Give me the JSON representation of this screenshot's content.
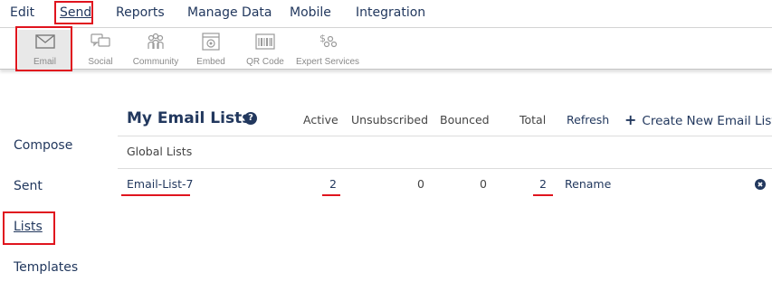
{
  "top_menu": [
    {
      "label": "Edit"
    },
    {
      "label": "Send"
    },
    {
      "label": "Reports"
    },
    {
      "label": "Manage Data"
    },
    {
      "label": "Mobile"
    },
    {
      "label": "Integration"
    }
  ],
  "toolbar": [
    {
      "label": "Email",
      "icon": "envelope-icon"
    },
    {
      "label": "Social",
      "icon": "social-icon"
    },
    {
      "label": "Community",
      "icon": "community-icon"
    },
    {
      "label": "Embed",
      "icon": "embed-icon"
    },
    {
      "label": "QR Code",
      "icon": "qr-code-icon"
    },
    {
      "label": "Expert Services",
      "icon": "expert-services-icon"
    }
  ],
  "side_nav": [
    {
      "label": "Compose"
    },
    {
      "label": "Sent"
    },
    {
      "label": "Lists"
    },
    {
      "label": "Templates"
    }
  ],
  "email_lists": {
    "title": "My Email Lists",
    "help_glyph": "?",
    "columns": {
      "active": "Active",
      "unsubscribed": "Unsubscribed",
      "bounced": "Bounced",
      "total": "Total",
      "refresh": "Refresh"
    },
    "create_label": "Create New Email List",
    "create_glyph": "+",
    "group_label": "Global Lists",
    "rows": [
      {
        "name": "Email-List-7",
        "active": "2",
        "unsubscribed": "0",
        "bounced": "0",
        "total": "2",
        "action": "Rename"
      }
    ]
  },
  "colors": {
    "text": "#22385e",
    "highlight": "#e0141e",
    "muted": "#8a8a8a"
  }
}
